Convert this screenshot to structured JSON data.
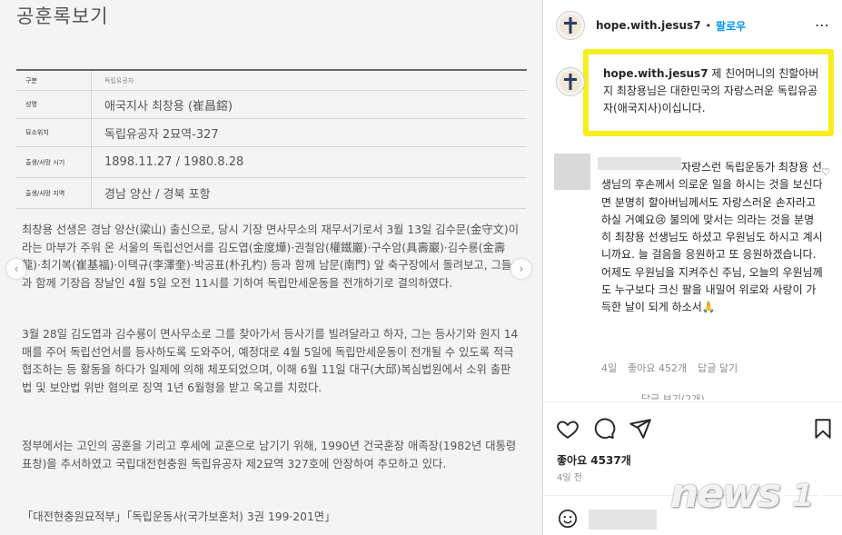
{
  "left_image": {
    "title": "공훈록보기",
    "table": [
      {
        "label": "구분",
        "value": "독립유공자"
      },
      {
        "label": "성명",
        "value": "애국지사 최창용 (崔昌鎔)"
      },
      {
        "label": "묘소위치",
        "value": "독립유공자 2묘역-327"
      },
      {
        "label": "출생/사망 시기",
        "value": "1898.11.27 / 1980.8.28"
      },
      {
        "label": "출생/사망 지역",
        "value": "경남 양산 / 경북 포항"
      }
    ],
    "paragraphs": [
      "최창용 선생은 경남 양산(梁山) 출신으로, 당시 기장 면사무소의 재무서기로서 3월 13일 김수문(金守文)이라는 마부가 주워 온 서울의 독립선언서를 김도엽(金度燁)·권철암(權鐵巖)·구수암(具壽巖)·김수룡(金壽龍)·최기복(崔基福)·이택규(李澤奎)·박공표(朴孔杓) 등과 함께 남문(南門) 앞 축구장에서 돌려보고, 그들과 함께 기장읍 장날인 4월 5일 오전 11시를 기하여 독립만세운동을 전개하기로 결의하였다.",
      "3월 28일 김도엽과 김수룡이 면사무소로 그를 찾아가서 등사기를 빌려달라고 하자, 그는 등사기와 원지 14매를 주어 독립선언서를 등사하도록 도와주어, 예정대로 4월 5일에 독립만세운동이 전개될 수 있도록 적극 협조하는 등 활동을 하다가 일제에 의해 체포되었으며, 이해 6월 11일 대구(大邱)복심법원에서 소위 출판법 및 보안법 위반 혐의로 징역 1년 6월형을 받고 옥고를 치렀다.",
      "정부에서는 고인의 공훈을 기리고 후세에 교훈으로 남기기 위해, 1990년 건국훈장 애족장(1982년 대통령표창)을 추서하였고 국립대전현충원 독립유공자 제2묘역 327호에 안장하여 추모하고 있다.",
      "「대전현충원묘적부」「독립운동사(국가보훈처) 3권 199·201면」"
    ]
  },
  "post": {
    "username": "hope.with.jesus7",
    "separator": "•",
    "follow_label": "팔로우",
    "more_icon": "⋯",
    "caption_user": "hope.with.jesus7",
    "caption_text": "제 친어머니의 친할아버지 최창용님은 대한민국의 자랑스러운 독립유공자(애국지사)이십니다.",
    "highlight_color": "#f6ef1b"
  },
  "comment": {
    "text": "자랑스런 독립운동가 최창용 선생님의 후손께서 의로운 일을 하시는 것을 보신다면 분명히 할아버님께서도 자랑스러운 손자라고 하실 거예요😢 불의에 맞서는 의라는 것을 분명히 최창용 선생님도 하셨고 우원님도 하시고 계시니까요. 늘 걸음을 응원하고 또 응원하겠습니다. 어제도 우원님을 지켜주신 주님, 오늘의 우원님께도 누구보다 크신 팔을 내밀어 위로와 사랑이 가득한 날이 되게 하소서🙏",
    "age": "4일",
    "likes": "좋아요 452개",
    "reply": "답글 달기",
    "view_replies": "답글 보기(2개)"
  },
  "footer": {
    "likes": "좋아요 4537개",
    "age": "4일 전"
  },
  "watermark": {
    "text": "news",
    "digit": "1"
  },
  "icons": {
    "heart": "heart-icon",
    "comment": "comment-icon",
    "share": "share-icon",
    "bookmark": "bookmark-icon",
    "emoji": "emoji-icon"
  }
}
